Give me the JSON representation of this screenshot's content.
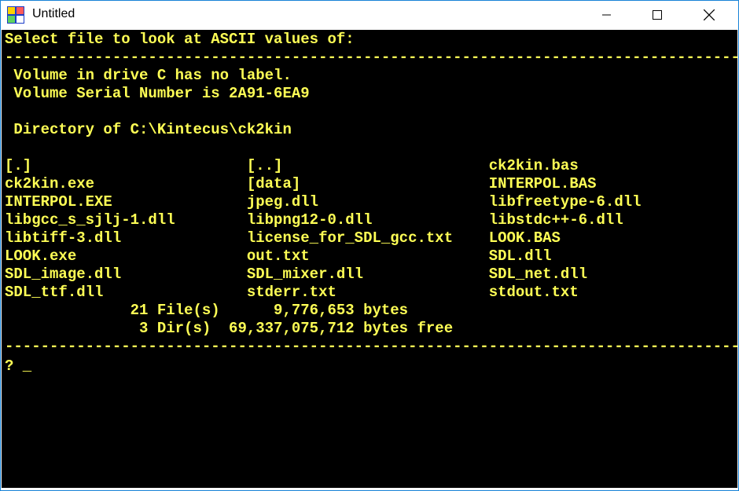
{
  "window": {
    "title": "Untitled",
    "app_icon": "qb64-icon",
    "controls": [
      "minimize-icon",
      "maximize-icon",
      "close-icon"
    ]
  },
  "console": {
    "text_color": "#ffff55",
    "background": "#000000",
    "lines": [
      "Select file to look at ASCII values of:",
      "----------------------------------------------------------------------------------",
      " Volume in drive C has no label.",
      " Volume Serial Number is 2A91-6EA9",
      "",
      " Directory of C:\\Kintecus\\ck2kin",
      "",
      "[.]                        [..]                       ck2kin.bas",
      "ck2kin.exe                 [data]                     INTERPOL.BAS",
      "INTERPOL.EXE               jpeg.dll                   libfreetype-6.dll",
      "libgcc_s_sjlj-1.dll        libpng12-0.dll             libstdc++-6.dll",
      "libtiff-3.dll              license_for_SDL_gcc.txt    LOOK.BAS",
      "LOOK.exe                   out.txt                    SDL.dll",
      "SDL_image.dll              SDL_mixer.dll              SDL_net.dll",
      "SDL_ttf.dll                stderr.txt                 stdout.txt",
      "              21 File(s)      9,776,653 bytes",
      "               3 Dir(s)  69,337,075,712 bytes free",
      "----------------------------------------------------------------------------------",
      "? _"
    ]
  }
}
